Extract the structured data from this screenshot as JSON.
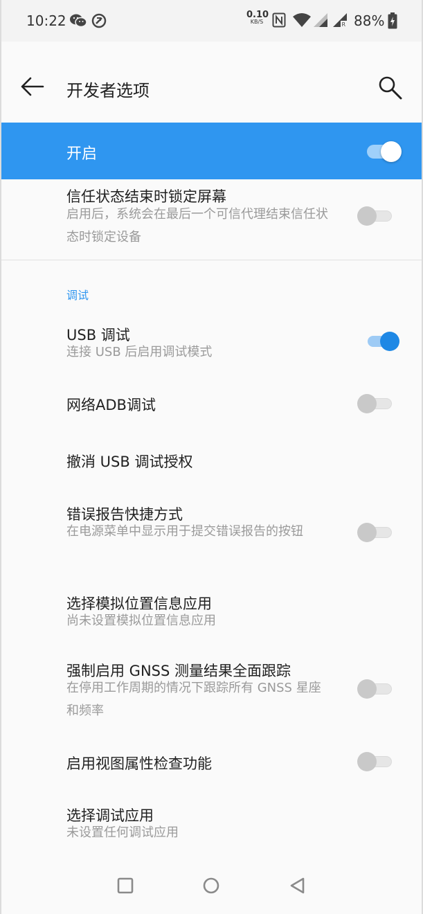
{
  "status_bar": {
    "time": "10:22",
    "net_speed_value": "0.10",
    "net_speed_unit": "KB/S",
    "battery": "88%"
  },
  "app_bar": {
    "title": "开发者选项"
  },
  "master_switch": {
    "label": "开启",
    "on": true
  },
  "items": [
    {
      "title": "信任状态结束时锁定屏幕",
      "subtitle": "启用后，系统会在最后一个可信代理结束信任状态时锁定设备",
      "toggle": false
    },
    {
      "title": "USB 调试",
      "subtitle": "连接 USB 后启用调试模式",
      "toggle": true
    },
    {
      "title": "网络ADB调试",
      "toggle": false
    },
    {
      "title": "撤消 USB 调试授权"
    },
    {
      "title": "错误报告快捷方式",
      "subtitle": "在电源菜单中显示用于提交错误报告的按钮",
      "toggle": false
    },
    {
      "title": "选择模拟位置信息应用",
      "subtitle": "尚未设置模拟位置信息应用"
    },
    {
      "title": "强制启用 GNSS 测量结果全面跟踪",
      "subtitle": "在停用工作周期的情况下跟踪所有 GNSS 星座和频率",
      "toggle": false
    },
    {
      "title": "启用视图属性检查功能",
      "toggle": false
    },
    {
      "title": "选择调试应用",
      "subtitle": "未设置任何调试应用"
    }
  ],
  "section_debug": "调试",
  "icons": {
    "wechat": "wechat-icon",
    "sync": "sync-icon",
    "nfc": "nfc-icon",
    "wifi": "wifi-icon",
    "signal": "signal-icon",
    "battery": "battery-icon",
    "back": "back-arrow-icon",
    "search": "search-icon",
    "recents": "recents-icon",
    "home": "home-icon",
    "nav_back": "nav-back-icon"
  },
  "colors": {
    "accent": "#2f96f0",
    "toggle_on": "#1e88e5"
  }
}
